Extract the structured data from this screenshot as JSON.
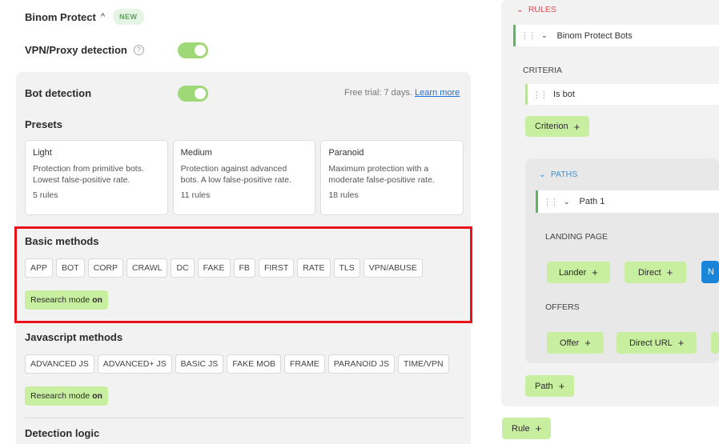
{
  "header": {
    "title": "Binom Protect",
    "caret": "^",
    "badge": "NEW"
  },
  "vpn": {
    "label": "VPN/Proxy detection",
    "help": "?"
  },
  "bot": {
    "label": "Bot detection",
    "trial": "Free trial: 7 days.",
    "learn_more": "Learn more"
  },
  "presets": {
    "heading": "Presets",
    "items": [
      {
        "name": "Light",
        "desc1": "Protection from primitive bots.",
        "desc2": "Lowest false-positive rate.",
        "count": "5 rules"
      },
      {
        "name": "Medium",
        "desc1": "Protection against advanced",
        "desc2": "bots. A low false-positive rate.",
        "count": "11 rules"
      },
      {
        "name": "Paranoid",
        "desc1": "Maximum protection with a",
        "desc2": "moderate false-positive rate.",
        "count": "18 rules"
      }
    ]
  },
  "basic": {
    "heading": "Basic methods",
    "chips": [
      "APP",
      "BOT",
      "CORP",
      "CRAWL",
      "DC",
      "FAKE",
      "FB",
      "FIRST",
      "RATE",
      "TLS",
      "VPN/ABUSE"
    ],
    "research_prefix": "Research mode",
    "research_state": "on"
  },
  "js": {
    "heading": "Javascript methods",
    "chips": [
      "ADVANCED JS",
      "ADVANCED+ JS",
      "BASIC JS",
      "FAKE MOB",
      "FRAME",
      "PARANOID JS",
      "TIME/VPN"
    ],
    "research_prefix": "Research mode",
    "research_state": "on"
  },
  "detection": {
    "heading": "Detection logic"
  },
  "rules": {
    "title": "RULES",
    "rule_name": "Binom Protect Bots",
    "criteria_label": "CRITERIA",
    "criterion_item": "Is bot",
    "criterion_button": "Criterion",
    "paths_title": "PATHS",
    "path_name": "Path 1",
    "landing_label": "LANDING PAGE",
    "lander_button": "Lander",
    "direct_button": "Direct",
    "blue_button": "N",
    "offers_label": "OFFERS",
    "offer_button": "Offer",
    "direct_url_button": "Direct URL",
    "path_button": "Path",
    "rule_button": "Rule"
  }
}
